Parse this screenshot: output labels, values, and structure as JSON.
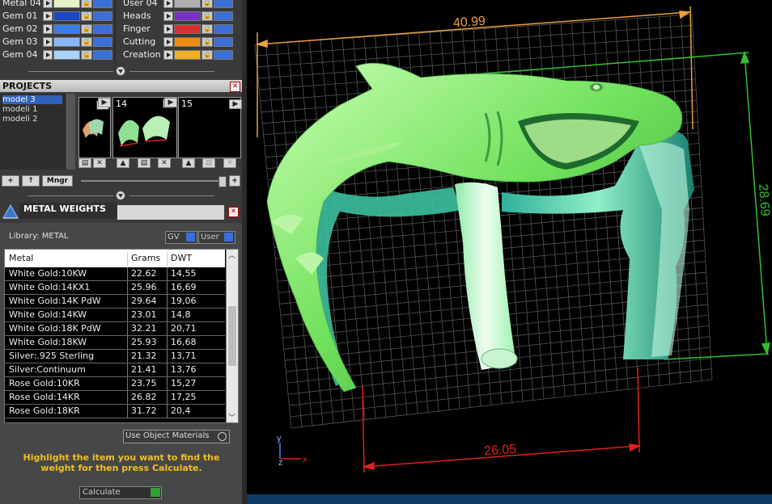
{
  "materials": {
    "left": [
      {
        "label": "Metal 04",
        "color": "#e6f2c8"
      },
      {
        "label": "Gem 01",
        "color": "#1a48c8"
      },
      {
        "label": "Gem 02",
        "color": "#3a7ee8"
      },
      {
        "label": "Gem 03",
        "color": "#8ab8f4"
      },
      {
        "label": "Gem 04",
        "color": "#a8d4f8"
      }
    ],
    "right": [
      {
        "label": "User 04",
        "color": "#b0b0b0"
      },
      {
        "label": "Heads",
        "color": "#7a2fc8"
      },
      {
        "label": "Finger",
        "color": "#d83030"
      },
      {
        "label": "Cutting",
        "color": "#f08a10"
      },
      {
        "label": "Creation",
        "color": "#f0b020"
      }
    ]
  },
  "projects": {
    "title": "PROJECTS",
    "items": [
      "model 3",
      "modeli 1",
      "modeli 2"
    ],
    "thumbs": [
      "",
      "14",
      "15"
    ],
    "buttons": [
      "+",
      "↑",
      "Mngr"
    ]
  },
  "metal_weights": {
    "title": "METAL WEIGHTS",
    "library_label": "Library: METAL",
    "toggle_gv": "GV",
    "toggle_user": "User",
    "headers": [
      "Metal",
      "Grams",
      "DWT"
    ],
    "rows": [
      [
        "White Gold:10KW",
        "22.62",
        "14,55"
      ],
      [
        "White Gold:14KX1",
        "25.96",
        "16,69"
      ],
      [
        "White Gold:14K PdW",
        "29.64",
        "19,06"
      ],
      [
        "White Gold:14KW",
        "23.01",
        "14,8"
      ],
      [
        "White Gold:18K PdW",
        "32.21",
        "20,71"
      ],
      [
        "White Gold:18KW",
        "25.93",
        "16,68"
      ],
      [
        "Silver:.925 Sterling",
        "21.32",
        "13,71"
      ],
      [
        "Silver:Continuum",
        "21.41",
        "13,76"
      ],
      [
        "Rose Gold:10KR",
        "23.75",
        "15,27"
      ],
      [
        "Rose Gold:14KR",
        "26.82",
        "17,25"
      ],
      [
        "Rose Gold:18KR",
        "31.72",
        "20,4"
      ]
    ],
    "use_object_materials": "Use Object Materials",
    "hint": "Highlight the item you want to find the weight for then press Calculate.",
    "calculate": "Calculate"
  },
  "viewport": {
    "dim_top": "40.99",
    "dim_right": "28.69",
    "dim_bottom": "26.05",
    "axis_y": "y",
    "axis_z": "z",
    "axis_x": "x"
  },
  "colors": {
    "dim_orange": "#e8a040",
    "dim_green": "#30c030",
    "dim_red": "#e02020",
    "hint_yellow": "#f0c020"
  }
}
